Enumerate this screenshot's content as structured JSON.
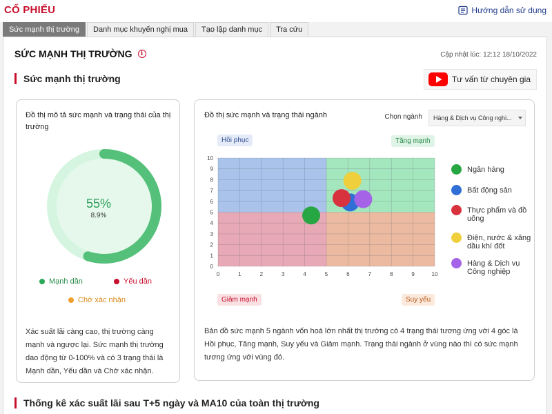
{
  "header": {
    "brand": "CỔ PHIẾU",
    "guide_label": "Hướng dẫn sử dụng"
  },
  "tabs": [
    {
      "label": "Sức mạnh thị trường",
      "active": true
    },
    {
      "label": "Danh mục khuyến nghị mua",
      "active": false
    },
    {
      "label": "Tạo lập danh mục",
      "active": false
    },
    {
      "label": "Tra cứu",
      "active": false
    }
  ],
  "main": {
    "title": "SỨC MẠNH THỊ TRƯỜNG",
    "updated_label": "Cập nhật lúc:",
    "updated_value": "12:12 18/10/2022",
    "section_title": "Sức mạnh thị trường",
    "expert_button": "Tư vấn từ chuyên gia",
    "bottom_section_title": "Thống kê xác suất lãi sau T+5 ngày và MA10 của toàn thị trường"
  },
  "gauge_card": {
    "title": "Đồ thị mô tả sức mạnh và trạng thái của thị trường",
    "value_label": "55%",
    "value": 55,
    "sub_label": "8.9%",
    "legend": [
      {
        "label": "Mạnh dần",
        "color": "#2aa85a"
      },
      {
        "label": "Yếu dần",
        "color": "#c8102e"
      },
      {
        "label": "Chờ xác nhận",
        "color": "#f0a030"
      }
    ],
    "description": "Xác suất lãi càng cao, thị trường càng mạnh và ngược lại. Sức mạnh thị trường dao động từ 0-100% và có 3 trạng thái là Mạnh dần, Yếu dần và Chờ xác nhận.",
    "colors": {
      "arc": "#55c07a",
      "track": "#d6f5e0",
      "inner": "#e6f8ec",
      "value_text": "#2e9e58"
    }
  },
  "sector_card": {
    "title": "Đồ thị sức mạnh và trạng thái ngành",
    "select_label": "Chọn ngành",
    "select_value": "Hàng & Dịch vụ Công nghi...",
    "quadrants": {
      "top_left": "Hồi phục",
      "top_right": "Tăng mạnh",
      "bottom_left": "Giảm mạnh",
      "bottom_right": "Suy yếu"
    },
    "description": "Bản đồ sức mạnh 5 ngành vốn hoá lớn nhất thị trường có 4 trạng thái tương ứng với 4 góc là Hồi phục, Tăng mạnh, Suy yếu và Giảm mạnh. Trạng thái ngành ở vùng nào thì có sức mạnh tương ứng với vùng đó.",
    "colors": {
      "q_top_left": "#a9c3ea",
      "q_top_right": "#a4e6bd",
      "q_bottom_left": "#e8a9b6",
      "q_bottom_right": "#ebbaa0"
    }
  },
  "chart_data": {
    "type": "scatter",
    "xlim": [
      0,
      10
    ],
    "ylim": [
      0,
      10
    ],
    "xticks": [
      "0",
      "1",
      "2",
      "3",
      "4",
      "5",
      "6",
      "7",
      "8",
      "9",
      "10"
    ],
    "yticks": [
      "0",
      "1",
      "2",
      "3",
      "4",
      "5",
      "6",
      "7",
      "8",
      "9",
      "10"
    ],
    "grid": true,
    "legend_position": "right",
    "series": [
      {
        "name": "Ngân hàng",
        "color": "#27a644",
        "x": 4.3,
        "y": 4.7
      },
      {
        "name": "Bất động sản",
        "color": "#2f6fd6",
        "x": 6.1,
        "y": 5.9
      },
      {
        "name": "Thực phẩm và đồ uống",
        "color": "#d9323f",
        "x": 5.7,
        "y": 6.3
      },
      {
        "name": "Điện, nước & xăng dầu khí đốt",
        "color": "#f0cf3c",
        "x": 6.2,
        "y": 7.9
      },
      {
        "name": "Hàng & Dịch vụ Công nghiệp",
        "color": "#a563e8",
        "x": 6.7,
        "y": 6.2
      }
    ]
  }
}
